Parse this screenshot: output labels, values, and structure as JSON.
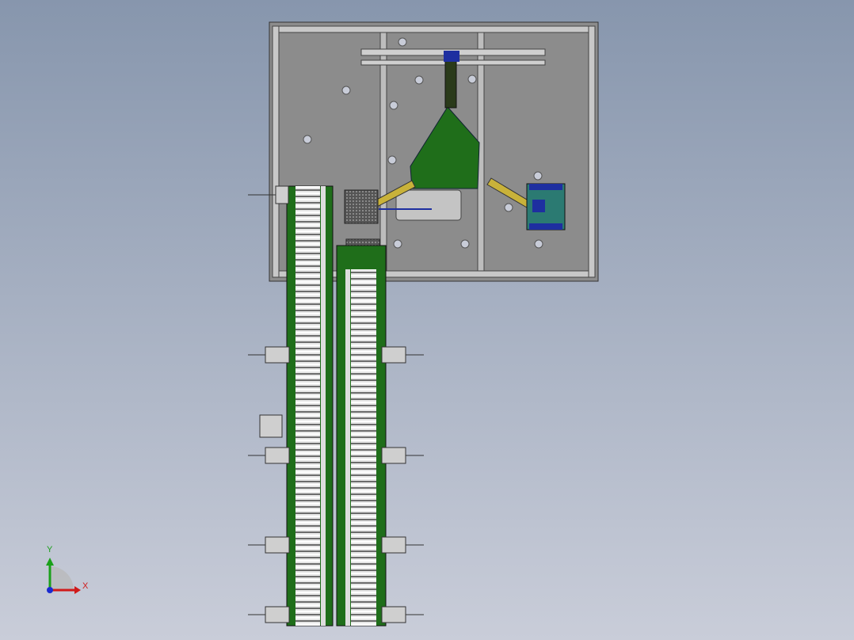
{
  "viewport": {
    "triad": {
      "x_label": "X",
      "y_label": "Y"
    },
    "colors": {
      "frame": "#8c8c8c",
      "green": "#1f6e1a",
      "roller": "#d8d8d8",
      "blue": "#1e2fa0",
      "teal": "#2b7a72"
    }
  }
}
